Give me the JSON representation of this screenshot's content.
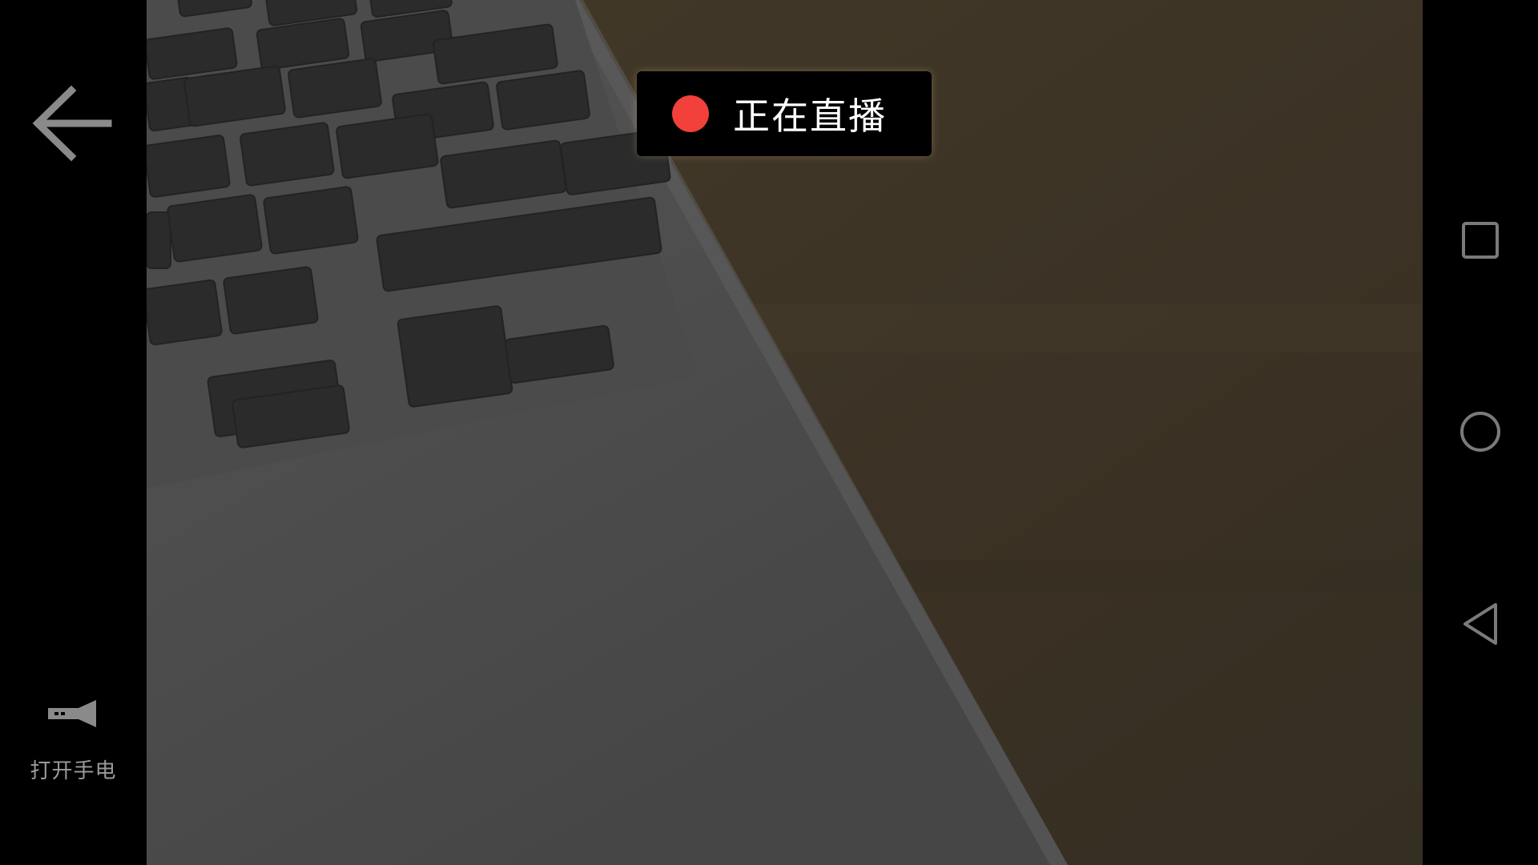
{
  "live_badge": {
    "text": "正在直播",
    "dot_color": "#f2403a"
  },
  "left_bar": {
    "back_icon": "arrow-left-icon",
    "torch": {
      "icon": "flashlight-icon",
      "label": "打开手电"
    }
  },
  "nav_bar": {
    "buttons": [
      {
        "icon": "square-recents-icon"
      },
      {
        "icon": "circle-home-icon"
      },
      {
        "icon": "triangle-back-icon"
      }
    ]
  },
  "colors": {
    "background": "#000000",
    "badge_background": "#000000",
    "icon_gray": "#8a8a8a",
    "nav_icon_gray": "#7a7a7a"
  }
}
